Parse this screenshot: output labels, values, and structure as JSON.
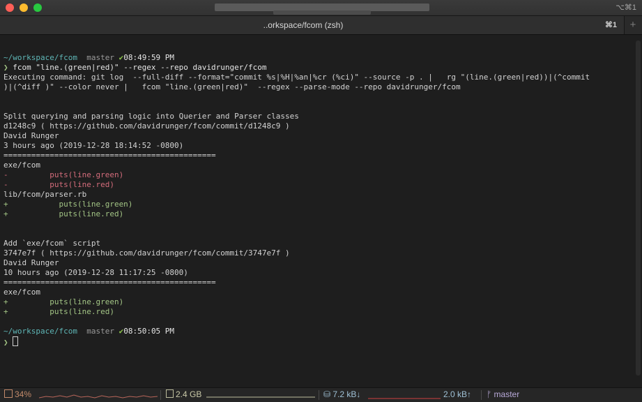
{
  "window": {
    "title_shortcut": "⌥⌘1"
  },
  "tab": {
    "title": "..orkspace/fcom (zsh)",
    "shortcut": "⌘1",
    "add_symbol": "+"
  },
  "terminal": {
    "lines": [
      {
        "segs": []
      },
      {
        "segs": [
          {
            "t": "~/workspace/fcom",
            "c": "cyan"
          },
          {
            "t": "  master ",
            "c": "gray"
          },
          {
            "t": "✔",
            "c": "check"
          },
          {
            "t": "08:49:59 PM",
            "c": "white"
          }
        ]
      },
      {
        "segs": [
          {
            "t": "❯",
            "c": "prompt-arrow"
          },
          {
            "t": " fcom \"line.(green|red)\" --regex --repo davidrunger/fcom",
            "c": "white"
          }
        ]
      },
      {
        "segs": [
          {
            "t": "Executing command: git log  --full-diff --format=\"commit %s|%H|%an|%cr (%ci)\" --source -p . |   rg \"(line.(green|red))|(^commit",
            "c": ""
          }
        ]
      },
      {
        "segs": [
          {
            "t": ")|(^diff )\" --color never |   fcom \"line.(green|red)\"  --regex --parse-mode --repo davidrunger/fcom",
            "c": ""
          }
        ]
      },
      {
        "segs": []
      },
      {
        "segs": []
      },
      {
        "segs": [
          {
            "t": "Split querying and parsing logic into Querier and Parser classes",
            "c": ""
          }
        ]
      },
      {
        "segs": [
          {
            "t": "d1248c9 ( https://github.com/davidrunger/fcom/commit/d1248c9 )",
            "c": ""
          }
        ]
      },
      {
        "segs": [
          {
            "t": "David Runger",
            "c": ""
          }
        ]
      },
      {
        "segs": [
          {
            "t": "3 hours ago (2019-12-28 18:14:52 -0800)",
            "c": ""
          }
        ]
      },
      {
        "segs": [
          {
            "t": "==============================================",
            "c": ""
          }
        ]
      },
      {
        "segs": [
          {
            "t": "exe/fcom",
            "c": ""
          }
        ]
      },
      {
        "segs": [
          {
            "t": "-         puts(line.green)",
            "c": "red"
          }
        ]
      },
      {
        "segs": [
          {
            "t": "-         puts(line.red)",
            "c": "red"
          }
        ]
      },
      {
        "segs": [
          {
            "t": "lib/fcom/parser.rb",
            "c": ""
          }
        ]
      },
      {
        "segs": [
          {
            "t": "+           puts(line.green)",
            "c": "green"
          }
        ]
      },
      {
        "segs": [
          {
            "t": "+           puts(line.red)",
            "c": "green"
          }
        ]
      },
      {
        "segs": []
      },
      {
        "segs": []
      },
      {
        "segs": [
          {
            "t": "Add `exe/fcom` script",
            "c": ""
          }
        ]
      },
      {
        "segs": [
          {
            "t": "3747e7f ( https://github.com/davidrunger/fcom/commit/3747e7f )",
            "c": ""
          }
        ]
      },
      {
        "segs": [
          {
            "t": "David Runger",
            "c": ""
          }
        ]
      },
      {
        "segs": [
          {
            "t": "10 hours ago (2019-12-28 11:17:25 -0800)",
            "c": ""
          }
        ]
      },
      {
        "segs": [
          {
            "t": "==============================================",
            "c": ""
          }
        ]
      },
      {
        "segs": [
          {
            "t": "exe/fcom",
            "c": ""
          }
        ]
      },
      {
        "segs": [
          {
            "t": "+         puts(line.green)",
            "c": "green"
          }
        ]
      },
      {
        "segs": [
          {
            "t": "+         puts(line.red)",
            "c": "green"
          }
        ]
      },
      {
        "segs": []
      },
      {
        "segs": [
          {
            "t": "~/workspace/fcom",
            "c": "cyan"
          },
          {
            "t": "  master ",
            "c": "gray"
          },
          {
            "t": "✔",
            "c": "check"
          },
          {
            "t": "08:50:05 PM",
            "c": "white"
          }
        ]
      },
      {
        "segs": [
          {
            "t": "❯ ",
            "c": "prompt-arrow"
          },
          {
            "t": "",
            "c": "cursor"
          }
        ]
      }
    ]
  },
  "status": {
    "cpu": "34%",
    "memory": "2.4 GB",
    "net_down": "7.2 kB↓",
    "net_up": "2.0 kB↑",
    "git_branch": "master",
    "git_icon": "ᚠ"
  }
}
